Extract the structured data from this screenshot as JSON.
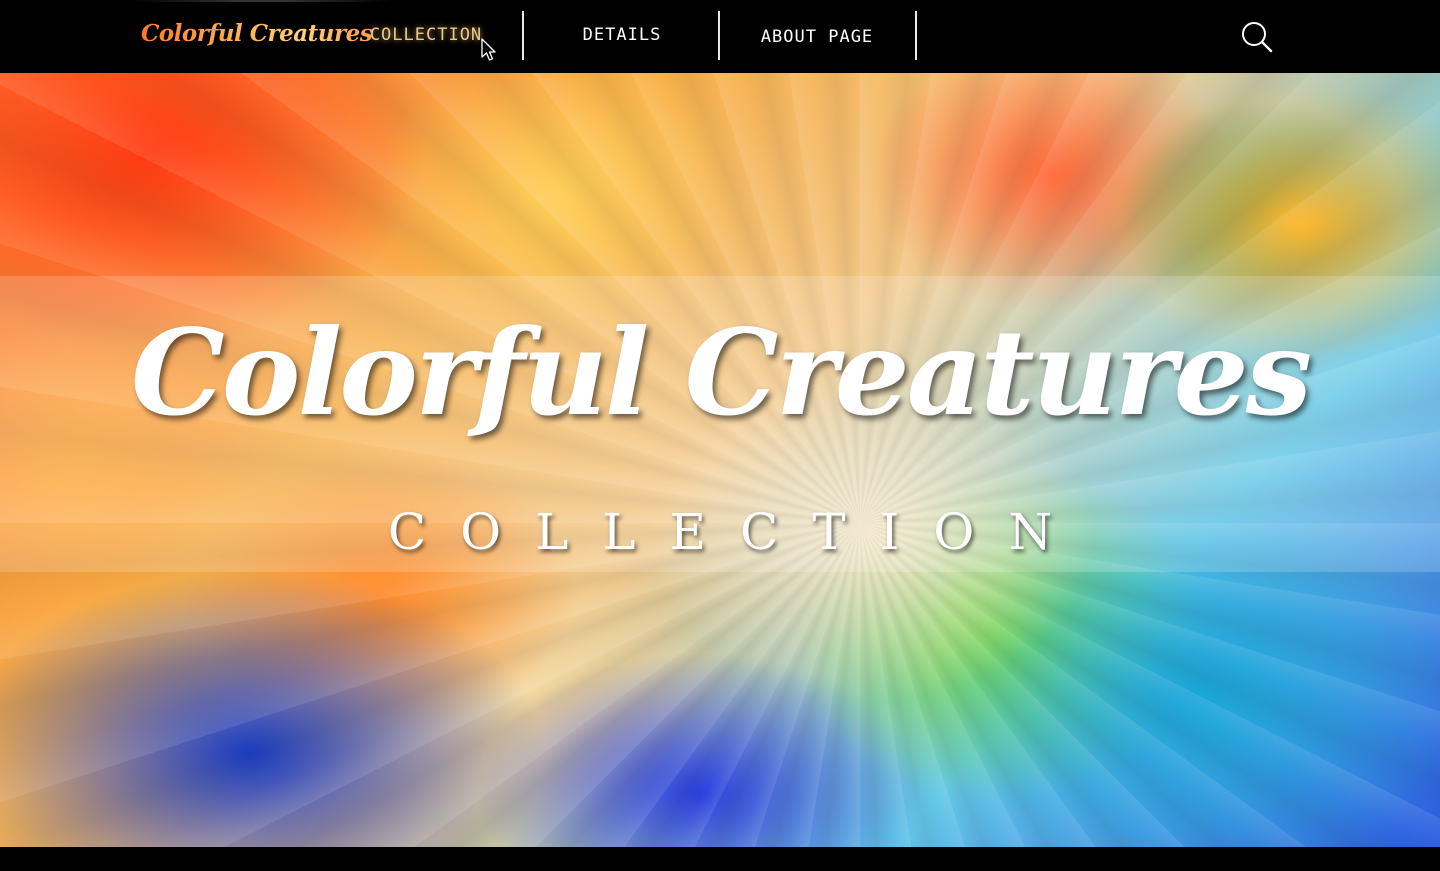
{
  "navbar": {
    "logo": "Colorful Creatures",
    "items": [
      {
        "label": "COLLECTION",
        "active": true
      },
      {
        "label": "DETAILS",
        "active": false
      },
      {
        "label": "ABOUT PAGE",
        "active": false
      }
    ],
    "search_icon": "search-icon",
    "accent_color": "#e8c98a"
  },
  "hero": {
    "title": "Colorful Creatures",
    "subtitle": "COLLECTION"
  }
}
